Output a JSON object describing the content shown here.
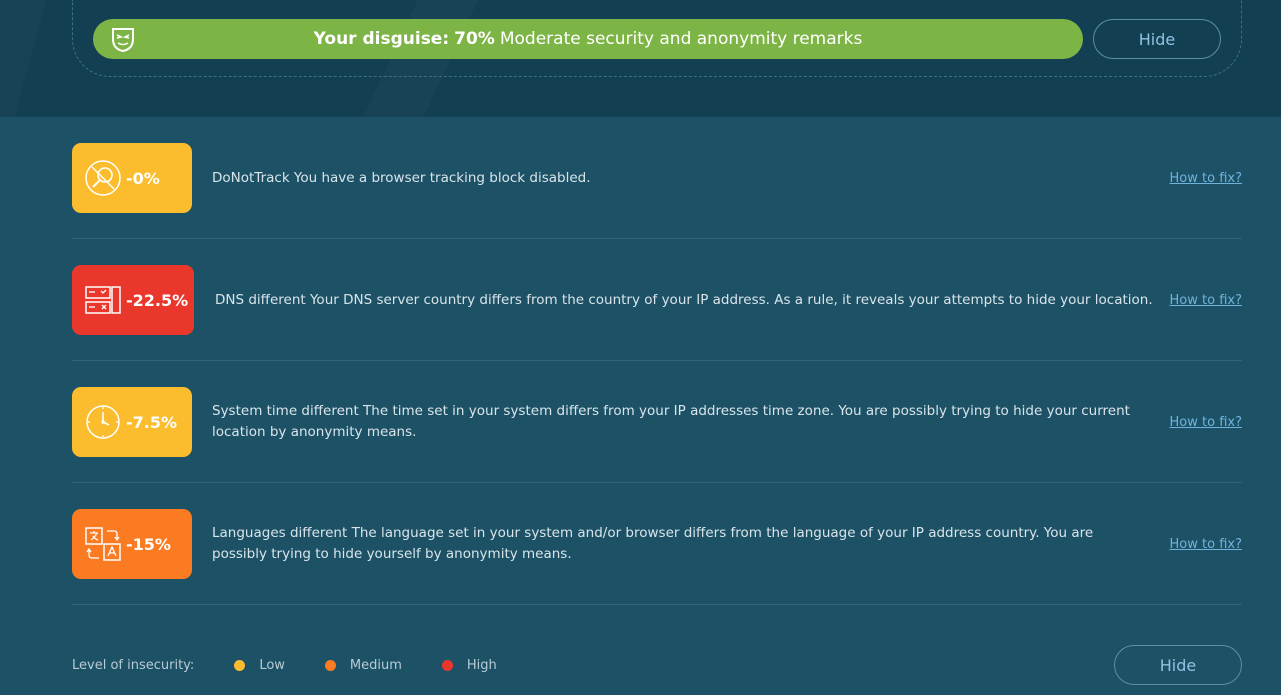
{
  "banner": {
    "label": "Your disguise:",
    "percent": "70%",
    "remark": "Moderate security and anonymity remarks",
    "hide_label": "Hide",
    "mask_icon": "anonymous-mask-icon",
    "color": "#7db446"
  },
  "checks": [
    {
      "badge": "-0%",
      "severity": "low",
      "icon": "tracking-search-icon",
      "text": "DoNotTrack You have a browser tracking block disabled.",
      "fix_label": "How to fix?"
    },
    {
      "badge": "-22.5%",
      "severity": "high",
      "icon": "dns-server-icon",
      "text": "DNS different Your DNS server country differs from the country of your IP address. As a rule, it reveals your attempts to hide your location.",
      "fix_label": "How to fix?"
    },
    {
      "badge": "-7.5%",
      "severity": "low",
      "icon": "clock-icon",
      "text": "System time different The time set in your system differs from your IP addresses time zone. You are possibly trying to hide your current location by anonymity means.",
      "fix_label": "How to fix?"
    },
    {
      "badge": "-15%",
      "severity": "medium",
      "icon": "language-translate-icon",
      "text": "Languages different The language set in your system and/or browser differs from the language of your IP address country. You are possibly trying to hide yourself by anonymity means.",
      "fix_label": "How to fix?"
    }
  ],
  "legend": {
    "title": "Level of insecurity:",
    "items": [
      {
        "label": "Low",
        "color": "#fbbc2e"
      },
      {
        "label": "Medium",
        "color": "#fb7b23"
      },
      {
        "label": "High",
        "color": "#e9382b"
      }
    ]
  },
  "footer": {
    "hide_label": "Hide"
  }
}
